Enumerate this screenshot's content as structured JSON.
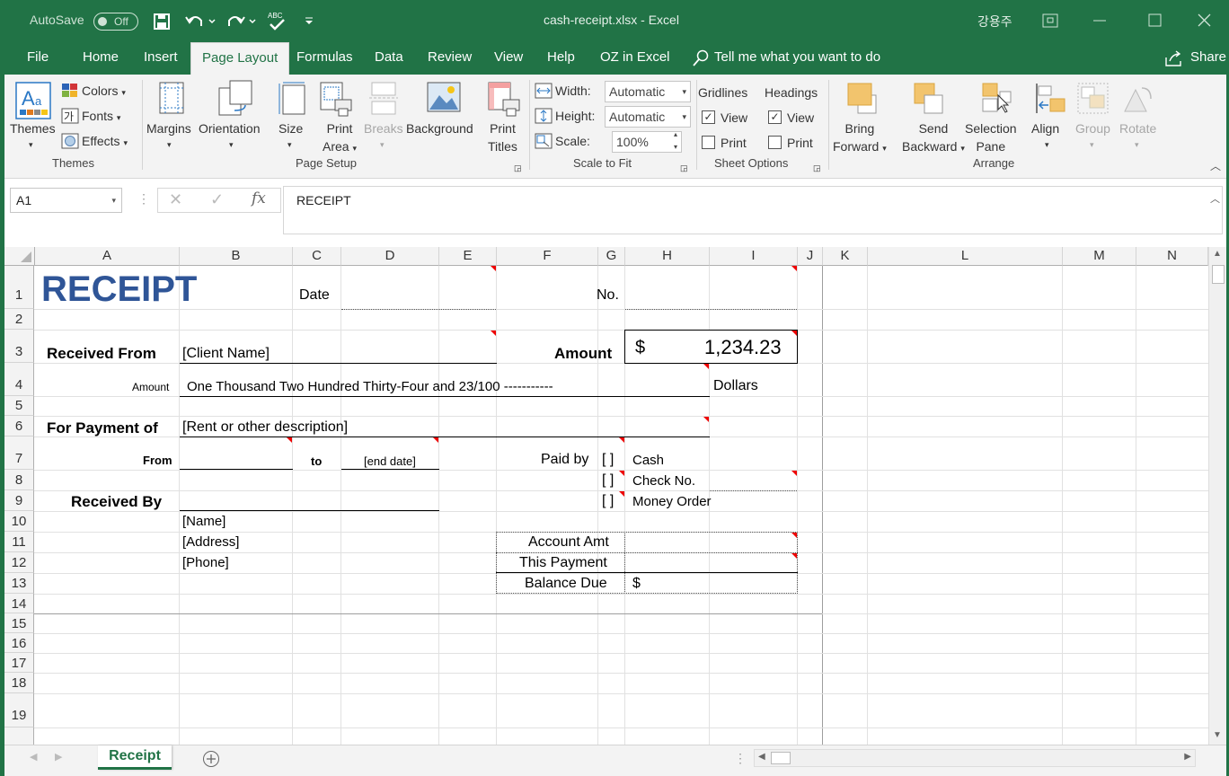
{
  "titlebar": {
    "autosave_label": "AutoSave",
    "autosave_state": "Off",
    "title": "cash-receipt.xlsx  -  Excel",
    "user": "강용주",
    "accent_color": "#217346"
  },
  "tabs": [
    "File",
    "Home",
    "Insert",
    "Page Layout",
    "Formulas",
    "Data",
    "Review",
    "View",
    "Help",
    "OZ in Excel"
  ],
  "active_tab": "Page Layout",
  "tell_me": "Tell me what you want to do",
  "share": "Share",
  "ribbon": {
    "themes": {
      "themes_label": "Themes",
      "colors": "Colors",
      "fonts": "Fonts",
      "effects": "Effects",
      "group": "Themes"
    },
    "page_setup": {
      "margins": "Margins",
      "orientation": "Orientation",
      "size": "Size",
      "print_area_1": "Print",
      "print_area_2": "Area",
      "breaks": "Breaks",
      "background": "Background",
      "print_titles_1": "Print",
      "print_titles_2": "Titles",
      "group": "Page Setup"
    },
    "scale": {
      "width_label": "Width:",
      "width_value": "Automatic",
      "height_label": "Height:",
      "height_value": "Automatic",
      "scale_label": "Scale:",
      "scale_value": "100%",
      "group": "Scale to Fit"
    },
    "sheet_options": {
      "gridlines": "Gridlines",
      "headings": "Headings",
      "view": "View",
      "print": "Print",
      "group": "Sheet Options"
    },
    "arrange": {
      "bring_1": "Bring",
      "bring_2": "Forward",
      "send_1": "Send",
      "send_2": "Backward",
      "selection_1": "Selection",
      "selection_2": "Pane",
      "align": "Align",
      "group_btn": "Group",
      "rotate": "Rotate",
      "group": "Arrange"
    }
  },
  "formula_bar": {
    "name_box": "A1",
    "formula": "RECEIPT"
  },
  "columns": [
    "A",
    "B",
    "C",
    "D",
    "E",
    "F",
    "G",
    "H",
    "I",
    "J",
    "K",
    "L",
    "M",
    "N"
  ],
  "rows": [
    "1",
    "2",
    "3",
    "4",
    "5",
    "6",
    "7",
    "8",
    "9",
    "10",
    "11",
    "12",
    "13",
    "14",
    "15",
    "16",
    "17",
    "18",
    "19"
  ],
  "sheet": {
    "title": "RECEIPT",
    "date_label": "Date",
    "no_label": "No.",
    "received_from": "Received From",
    "client_name": "[Client Name]",
    "amount_label": "Amount",
    "currency": "$",
    "amount_value": "1,234.23",
    "amount_small": "Amount",
    "amount_words": "One Thousand Two Hundred Thirty-Four and 23/100 -----------",
    "dollars": "Dollars",
    "for_payment": "For Payment of",
    "payment_desc": "[Rent or other description]",
    "from": "From",
    "to": "to",
    "end_date": "[end date]",
    "paid_by": "Paid by",
    "bracket": "[  ]",
    "cash": "Cash",
    "check_no": "Check No.",
    "money_order": "Money Order",
    "received_by": "Received By",
    "name": "[Name]",
    "address": "[Address]",
    "phone": "[Phone]",
    "account_amt": "Account Amt",
    "this_payment": "This Payment",
    "balance_due": "Balance Due",
    "balance_currency": "$",
    "title_color": "#2f5597"
  },
  "sheet_tab": "Receipt"
}
